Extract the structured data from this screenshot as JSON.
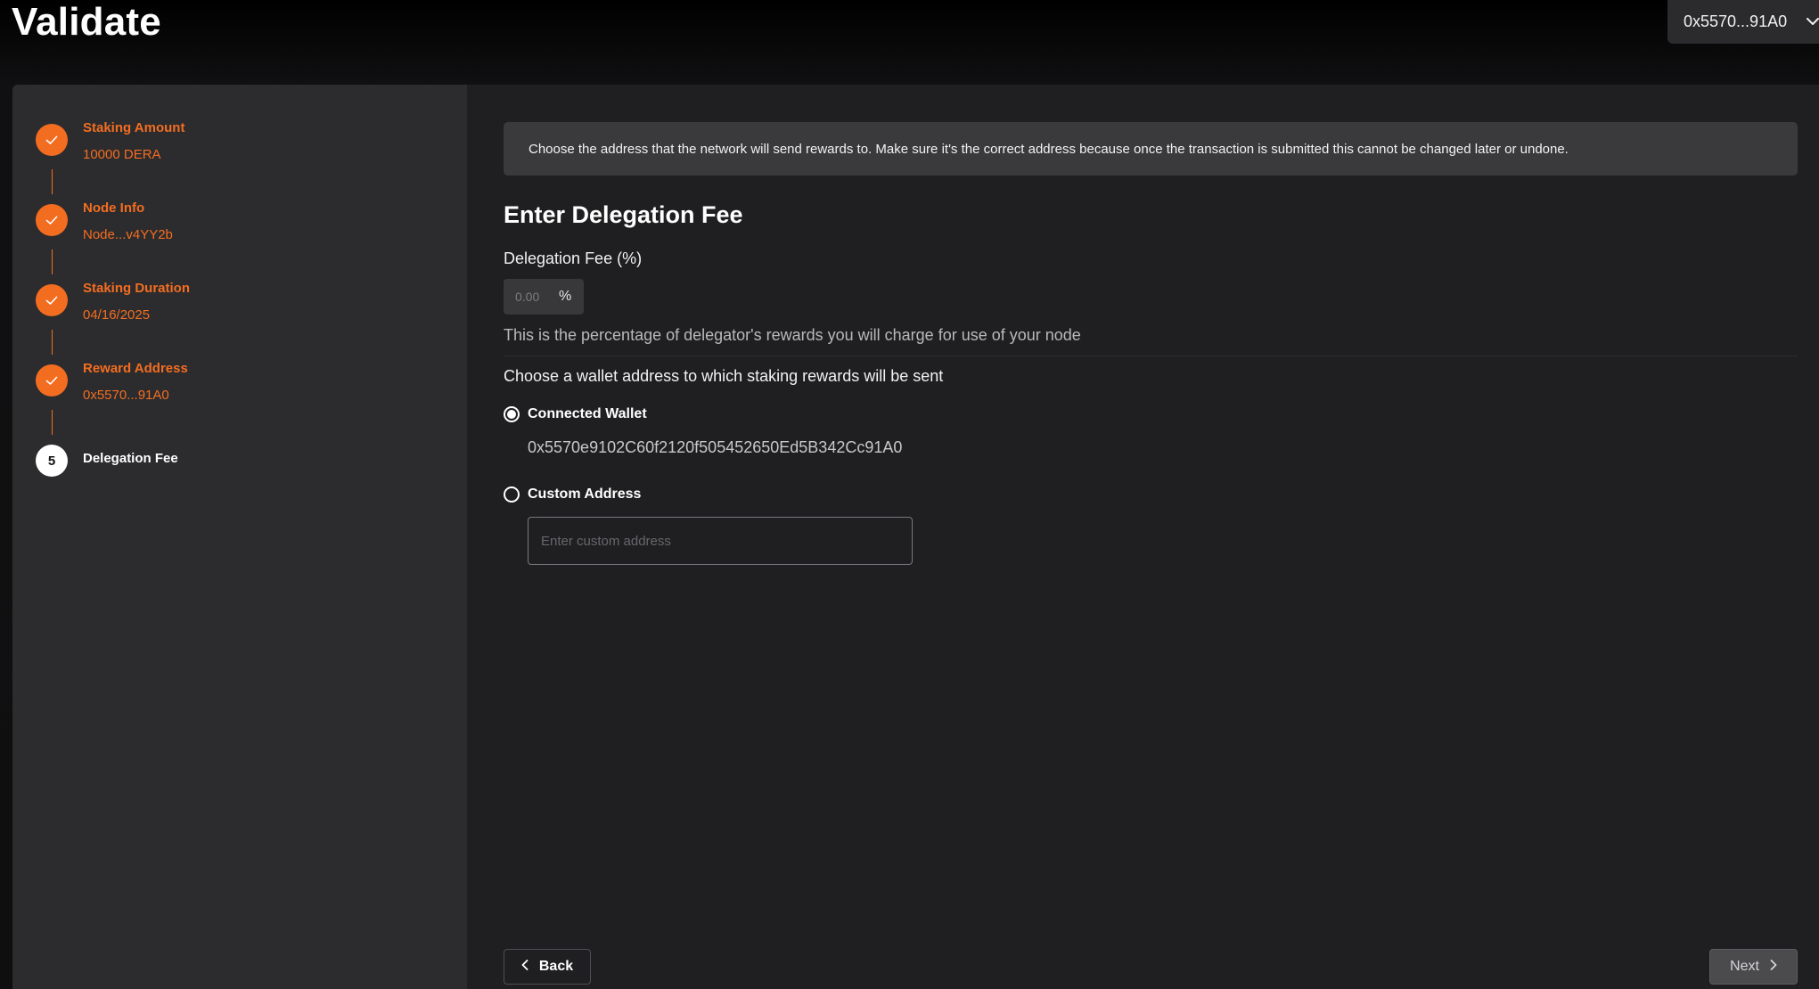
{
  "header": {
    "title": "Validate",
    "wallet_button_label": "0x5570...91A0",
    "wallet_button_icon": "chevron-down-icon"
  },
  "steps": [
    {
      "number": "1",
      "title": "Staking Amount",
      "value": "10000 DERA",
      "status": "completed"
    },
    {
      "number": "2",
      "title": "Node Info",
      "value": "Node...v4YY2b",
      "status": "completed"
    },
    {
      "number": "3",
      "title": "Staking Duration",
      "value": "04/16/2025",
      "status": "completed"
    },
    {
      "number": "4",
      "title": "Reward Address",
      "value": "0x5570...91A0",
      "status": "completed"
    },
    {
      "number": "5",
      "title": "Delegation Fee",
      "value": "",
      "status": "current"
    }
  ],
  "main": {
    "info_text": "Choose the address that the network will send rewards to. Make sure it's the correct address because once the transaction is submitted this cannot be changed later or undone.",
    "section_title": "Enter Delegation Fee",
    "fee_label": "Delegation Fee (%)",
    "fee_placeholder": "0.00",
    "fee_suffix": "%",
    "fee_helper": "This is the percentage of delegator's rewards you will charge for use of your node",
    "address_prompt": "Choose a wallet address to which staking rewards will be sent",
    "options": {
      "connected_label": "Connected Wallet",
      "connected_selected": true,
      "connected_address": "0x5570e9102C60f2120f505452650Ed5B342Cc91A0",
      "custom_label": "Custom Address",
      "custom_selected": false,
      "custom_placeholder": "Enter custom address"
    }
  },
  "footer": {
    "back_label": "Back",
    "next_label": "Next"
  },
  "colors": {
    "accent": "#f36d21",
    "sidebar_bg": "#2c2c2e",
    "panel_bg": "#1f1f21",
    "info_bg": "#3a3a3d"
  }
}
